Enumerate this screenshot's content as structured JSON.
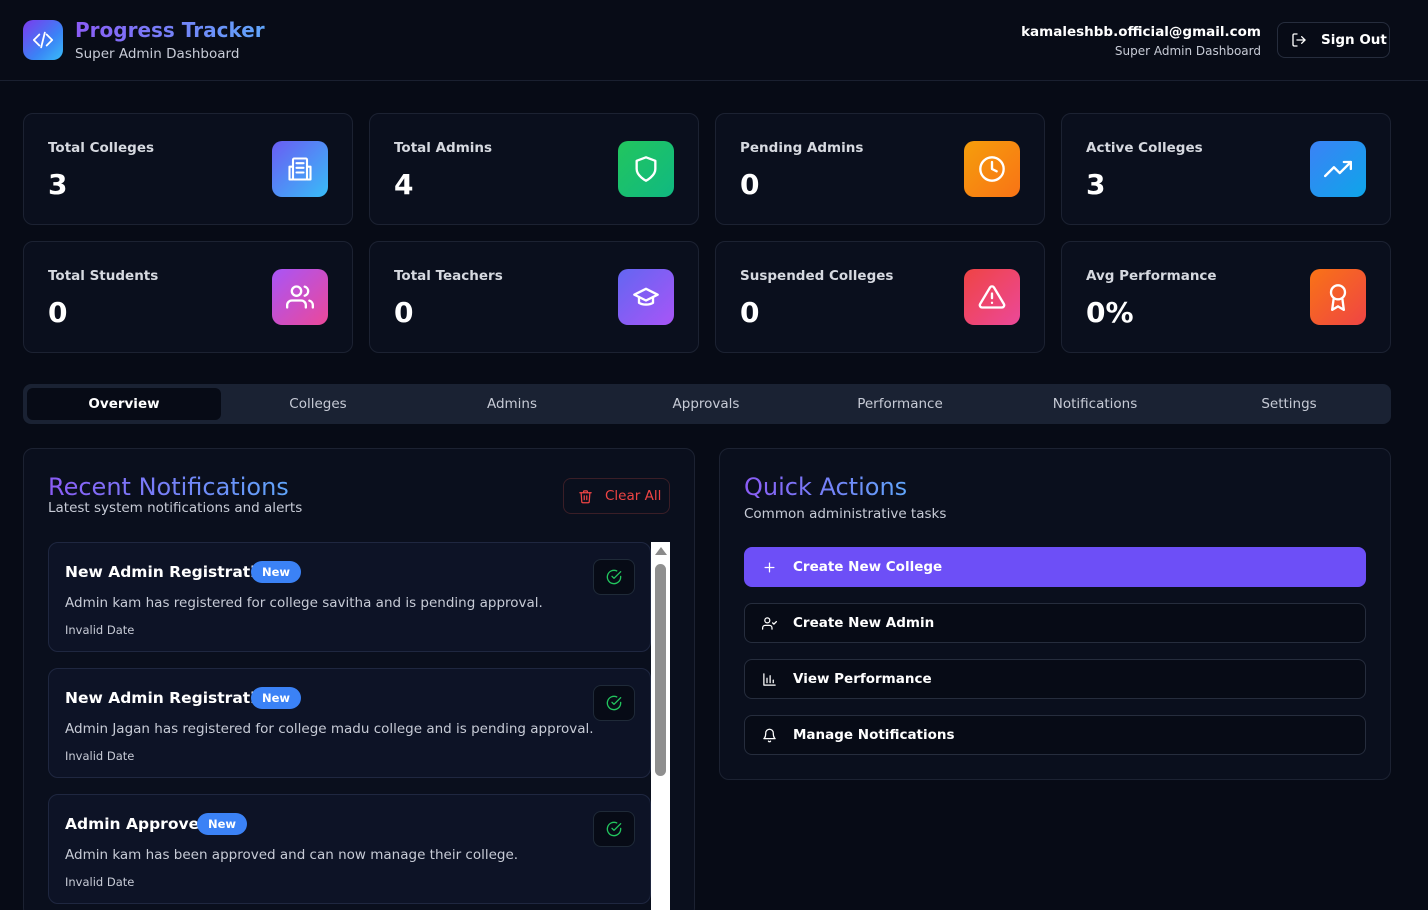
{
  "header": {
    "app_title": "Progress Tracker",
    "app_subtitle": "Super Admin Dashboard",
    "user_email": "kamaleshbb.official@gmail.com",
    "user_role": "Super Admin Dashboard",
    "sign_out_label": "Sign Out"
  },
  "stats": [
    {
      "label": "Total Colleges",
      "value": "3",
      "icon": "building-icon",
      "color": "#4f7df5"
    },
    {
      "label": "Total Admins",
      "value": "4",
      "icon": "shield-icon",
      "color": "#16b364"
    },
    {
      "label": "Pending Admins",
      "value": "0",
      "icon": "clock-icon",
      "color": "#f59e0b"
    },
    {
      "label": "Active Colleges",
      "value": "3",
      "icon": "trending-up-icon",
      "color": "#2b8ef0"
    },
    {
      "label": "Total Students",
      "value": "0",
      "icon": "users-icon",
      "color": "#c84fe0"
    },
    {
      "label": "Total Teachers",
      "value": "0",
      "icon": "graduation-cap-icon",
      "color": "#7c5cf5"
    },
    {
      "label": "Suspended Colleges",
      "value": "0",
      "icon": "alert-triangle-icon",
      "color": "#ef4466"
    },
    {
      "label": "Avg Performance",
      "value": "0%",
      "icon": "award-icon",
      "color": "#f4611d"
    }
  ],
  "tabs": [
    {
      "label": "Overview",
      "active": true
    },
    {
      "label": "Colleges"
    },
    {
      "label": "Admins"
    },
    {
      "label": "Approvals"
    },
    {
      "label": "Performance"
    },
    {
      "label": "Notifications"
    },
    {
      "label": "Settings"
    }
  ],
  "notifications_panel": {
    "title": "Recent Notifications",
    "subtitle": "Latest system notifications and alerts",
    "clear_all_label": "Clear All",
    "items": [
      {
        "title": "New Admin Registration",
        "badge": "New",
        "message": "Admin kam has registered for college savitha and is pending approval.",
        "date": "Invalid Date"
      },
      {
        "title": "New Admin Registration",
        "badge": "New",
        "message": "Admin Jagan has registered for college madu college and is pending approval.",
        "date": "Invalid Date"
      },
      {
        "title": "Admin Approved",
        "badge": "New",
        "message": "Admin kam has been approved and can now manage their college.",
        "date": "Invalid Date"
      }
    ]
  },
  "quick_actions": {
    "title": "Quick Actions",
    "subtitle": "Common administrative tasks",
    "items": [
      {
        "label": "Create New College",
        "icon": "plus-icon"
      },
      {
        "label": "Create New Admin",
        "icon": "user-check-icon"
      },
      {
        "label": "View Performance",
        "icon": "bar-chart-icon"
      },
      {
        "label": "Manage Notifications",
        "icon": "bell-icon"
      }
    ]
  },
  "colors": {
    "background": "#070b16",
    "accent": "#6d4ff7",
    "badge": "#3b82f6",
    "danger": "#ef4444"
  }
}
